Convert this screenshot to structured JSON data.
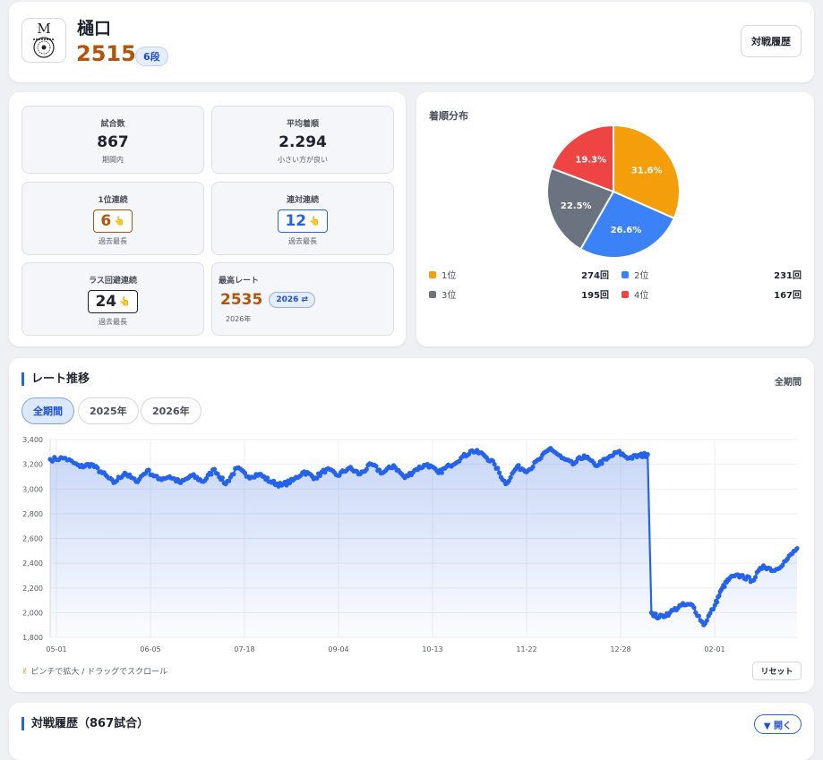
{
  "profile": {
    "avatar_mark": "M",
    "name": "樋口",
    "rate": "2515",
    "rank": "6段",
    "history_button": "対戦履歴"
  },
  "stats": {
    "games": {
      "label": "試合数",
      "value": "867",
      "sub": "期間内"
    },
    "avg_rank": {
      "label": "平均着順",
      "value": "2.294",
      "sub": "小さい方が良い"
    },
    "first_streak": {
      "label": "1位連続",
      "value": "6",
      "sub": "過去最長"
    },
    "rentai_streak": {
      "label": "連対連続",
      "value": "12",
      "sub": "過去最長"
    },
    "last_avoid_streak": {
      "label": "ラス回避連続",
      "value": "24",
      "sub": "過去最長"
    },
    "best_rate": {
      "label": "最高レート",
      "value": "2535",
      "button": "2026 ⇄",
      "sub": "2026年"
    },
    "hand_icon": "👆"
  },
  "distribution": {
    "title": "着順分布",
    "items": [
      {
        "label": "1位",
        "count": "274回",
        "percent": "31.6%",
        "value": 274,
        "color": "#f59e0b"
      },
      {
        "label": "2位",
        "count": "231回",
        "percent": "26.6%",
        "value": 231,
        "color": "#3b82f6"
      },
      {
        "label": "3位",
        "count": "195回",
        "percent": "22.5%",
        "value": 195,
        "color": "#6b7280"
      },
      {
        "label": "4位",
        "count": "167回",
        "percent": "19.3%",
        "value": 167,
        "color": "#ef4444"
      }
    ]
  },
  "rate_chart": {
    "title": "レート推移",
    "scope": "全期間",
    "tabs": [
      "全期間",
      "2025年",
      "2026年"
    ],
    "active_tab": 0,
    "hint": "ピンチで拡大 / ドラッグでスクロール",
    "reset": "リセット"
  },
  "chart_data": {
    "type": "line",
    "x_ticks": [
      "05-01",
      "06-05",
      "07-18",
      "09-04",
      "10-13",
      "11-22",
      "12-28",
      "02-01"
    ],
    "y_ticks": [
      "1,800",
      "2,000",
      "2,200",
      "2,400",
      "2,600",
      "2,800",
      "3,000",
      "3,200",
      "3,400"
    ],
    "ylim": [
      1800,
      3400
    ],
    "grid": true,
    "line_color": "#2563eb",
    "series": [
      {
        "x": [
          0,
          0.02,
          0.04,
          0.055,
          0.07,
          0.085,
          0.1,
          0.115,
          0.13,
          0.145,
          0.16,
          0.175,
          0.19,
          0.205,
          0.22,
          0.235,
          0.25,
          0.265,
          0.28,
          0.295,
          0.31,
          0.325,
          0.34,
          0.355,
          0.37,
          0.385,
          0.4,
          0.415,
          0.43,
          0.445,
          0.46,
          0.475,
          0.49,
          0.505,
          0.52,
          0.535,
          0.55,
          0.565,
          0.58,
          0.595,
          0.61,
          0.625,
          0.64,
          0.655,
          0.67,
          0.685,
          0.7,
          0.715,
          0.73,
          0.745,
          0.76,
          0.775,
          0.79,
          0.8,
          0.805,
          0.815,
          0.83,
          0.845,
          0.86,
          0.875,
          0.89,
          0.9,
          0.91,
          0.925,
          0.94,
          0.955,
          0.97,
          0.985,
          1.0
        ],
        "y": [
          3240,
          3250,
          3180,
          3200,
          3130,
          3050,
          3130,
          3060,
          3150,
          3080,
          3100,
          3050,
          3110,
          3060,
          3160,
          3040,
          3170,
          3100,
          3120,
          3060,
          3030,
          3070,
          3140,
          3090,
          3160,
          3110,
          3170,
          3120,
          3200,
          3130,
          3190,
          3090,
          3160,
          3200,
          3130,
          3190,
          3250,
          3310,
          3280,
          3200,
          3040,
          3180,
          3150,
          3240,
          3330,
          3250,
          3200,
          3270,
          3190,
          3240,
          3300,
          3250,
          3270,
          3280,
          2000,
          1960,
          2000,
          2060,
          2060,
          1900,
          2060,
          2200,
          2280,
          2300,
          2260,
          2380,
          2340,
          2420,
          2520
        ]
      }
    ]
  },
  "history": {
    "title": "対戦履歴（867試合）",
    "open_button": "▼ 開く"
  }
}
